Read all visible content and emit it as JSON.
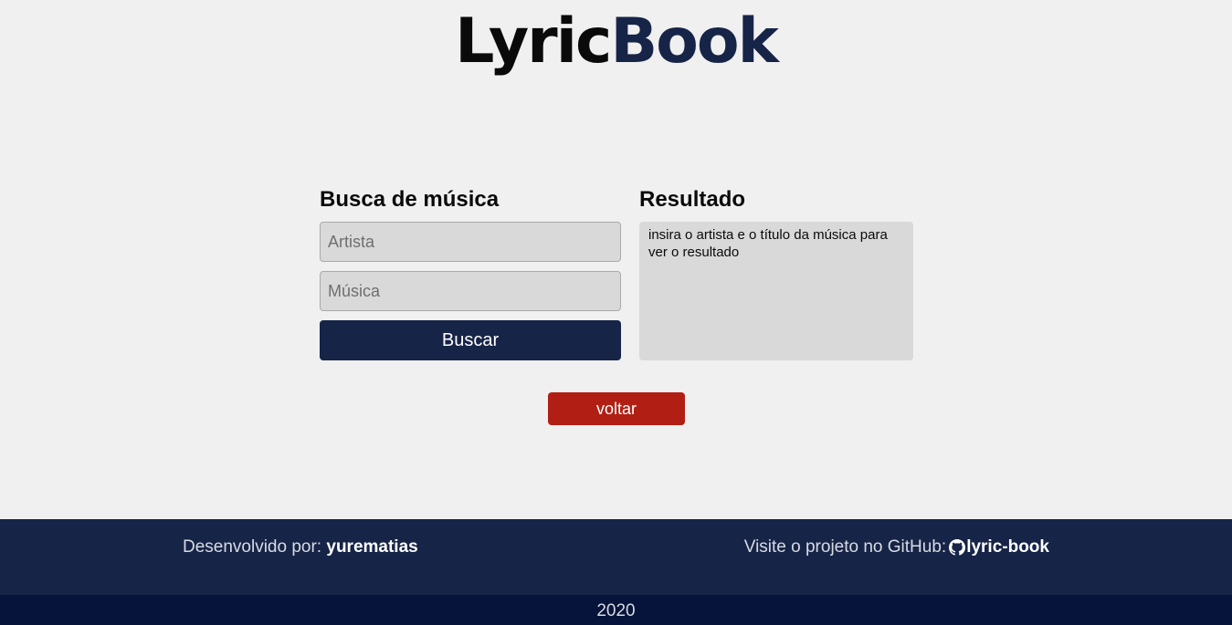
{
  "logo": {
    "part1": "Lyric",
    "part2": "Book"
  },
  "search": {
    "title": "Busca de música",
    "artist_placeholder": "Artista",
    "artist_value": "",
    "song_placeholder": "Música",
    "song_value": "",
    "submit_label": "Buscar"
  },
  "result": {
    "title": "Resultado",
    "text": "insira o artista e o título da música para ver o resultado"
  },
  "back_label": "voltar",
  "footer": {
    "dev_prefix": "Desenvolvido por:",
    "dev_name": "yurematias",
    "github_prefix": "Visite o projeto no GitHub:",
    "github_icon": "github-icon",
    "github_repo": "lyric-book",
    "year": "2020"
  },
  "colors": {
    "background": "#f0f0f0",
    "navy": "#162447",
    "navy_dark": "#06133a",
    "danger": "#b11f14",
    "input_bg": "#d9d9d9"
  }
}
